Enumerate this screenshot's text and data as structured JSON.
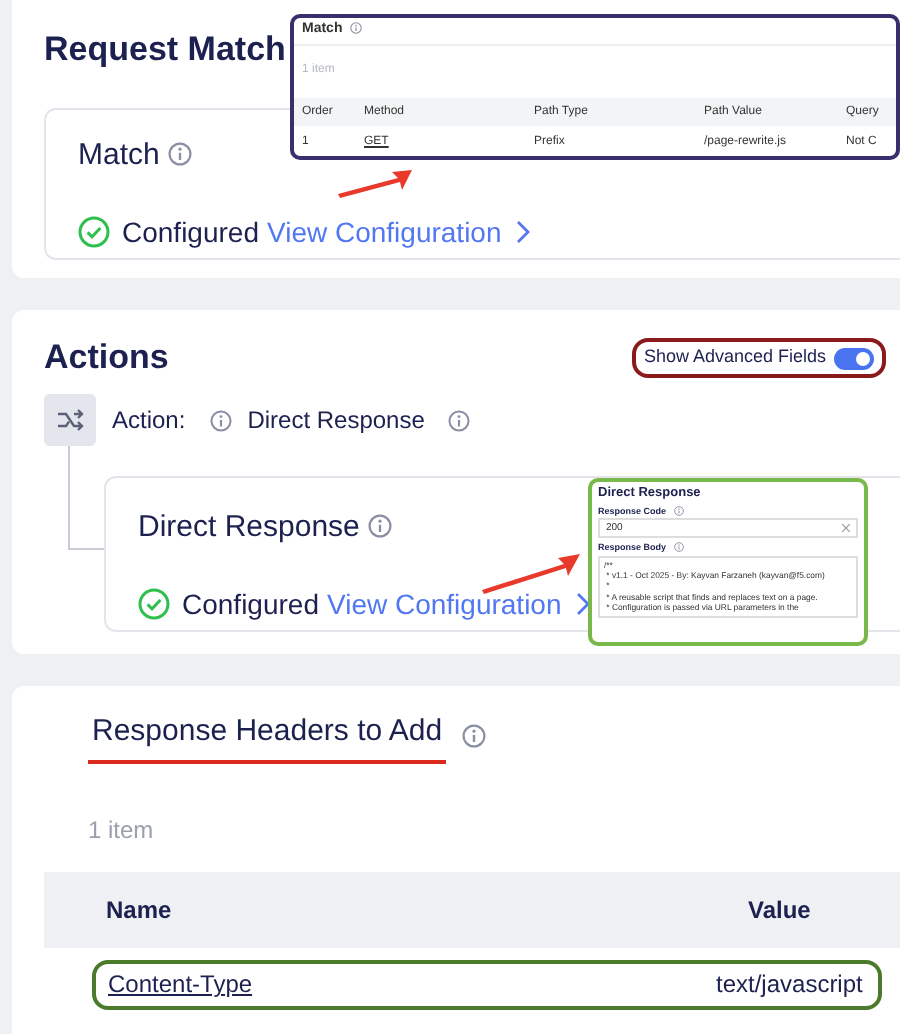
{
  "request_match": {
    "title": "Request Match",
    "match": {
      "title": "Match",
      "status": "Configured",
      "link": "View Configuration",
      "configured": true
    }
  },
  "match_popup": {
    "title": "Match",
    "count": "1 item",
    "columns": [
      "Order",
      "Method",
      "Path Type",
      "Path Value",
      "Query"
    ],
    "rows": [
      {
        "order": "1",
        "method": "GET",
        "path_type": "Prefix",
        "path_value": "/page-rewrite.js",
        "query": "Not C"
      }
    ]
  },
  "actions": {
    "title": "Actions",
    "toggle": {
      "label": "Show Advanced Fields",
      "on": true
    },
    "action": {
      "prefix": "Action:",
      "name": "Direct Response"
    },
    "direct_response": {
      "title": "Direct Response",
      "status": "Configured",
      "link": "View Configuration",
      "configured": true
    }
  },
  "direct_response_popup": {
    "title": "Direct Response",
    "code_label": "Response Code",
    "code_value": "200",
    "body_label": "Response Body",
    "body_lines": [
      "/**",
      " * v1.1 - Oct 2025 - By: Kayvan Farzaneh (kayvan@f5.com)",
      " *",
      " * A reusable script that finds and replaces text on a page.",
      " * Configuration is passed via URL parameters in the"
    ]
  },
  "response_headers": {
    "title": "Response Headers to Add",
    "count": "1 item",
    "columns": [
      "Name",
      "Value"
    ],
    "rows": [
      {
        "name": "Content-Type",
        "value": "text/javascript"
      }
    ]
  }
}
